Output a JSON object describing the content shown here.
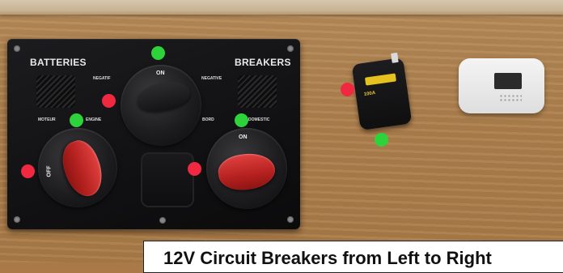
{
  "panel": {
    "batteries_label": "BATTERIES",
    "breakers_label": "BREAKERS",
    "negatif_label": "NEGATIF",
    "negative_label": "NEGATIVE",
    "on_label": "ON",
    "moteur_label": "MOTEUR",
    "engine_label": "ENGINE",
    "bord_label": "BORD",
    "domestic_label": "DOMESTIC",
    "off_label": "OFF",
    "on2_label": "ON"
  },
  "breaker": {
    "rating_label": "100A"
  },
  "caption": {
    "text": "12V Circuit Breakers from Left to Right"
  },
  "colors": {
    "marker_green": "#2ed23a",
    "marker_red": "#f02840",
    "knob_red": "#c42a27",
    "panel_black": "#121214"
  }
}
